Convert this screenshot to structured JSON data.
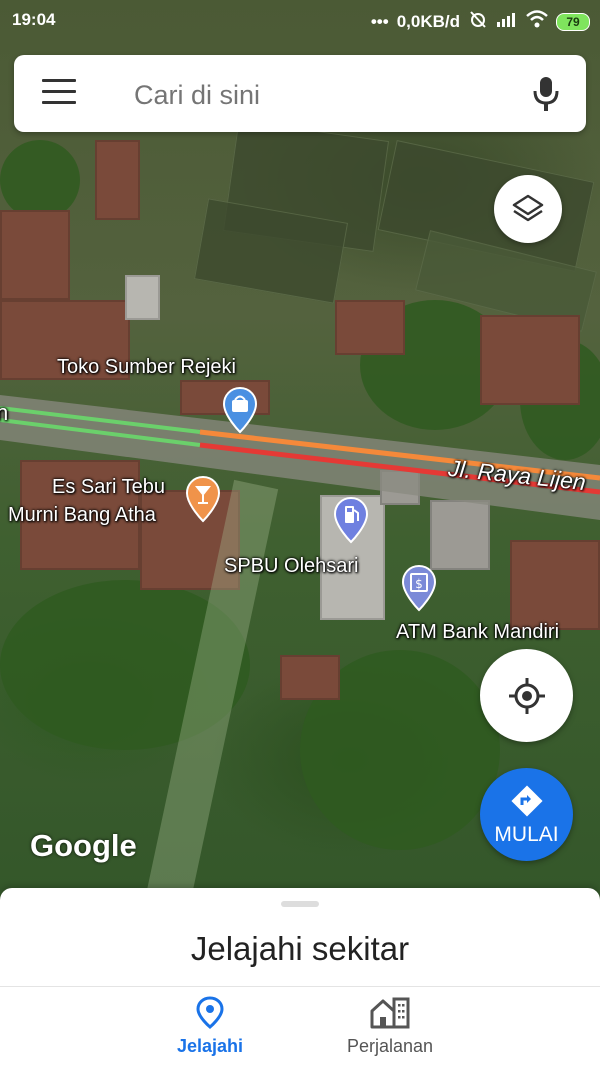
{
  "status_bar": {
    "time": "19:04",
    "network_speed": "0,0KB/d",
    "battery": "79",
    "icons": [
      "dots-icon",
      "alarm-off-icon",
      "signal-icon",
      "wifi-icon",
      "battery-icon"
    ]
  },
  "search": {
    "placeholder": "Cari di sini",
    "menu_icon": "hamburger-menu-icon",
    "mic_icon": "microphone-icon"
  },
  "map": {
    "labels": {
      "shop": "Toko Sumber Rejeki",
      "drink_line1": "Es Sari Tebu",
      "drink_line2": "Murni Bang Atha",
      "gas": "SPBU Olehsari",
      "atm": "ATM Bank Mandiri",
      "road": "Jl. Raya Lijen",
      "road_left_fragment": "n"
    },
    "pin_colors": {
      "shop": "#4a90e2",
      "drink": "#f0934a",
      "gas": "#6f80e0",
      "atm": "#7b8ad8"
    },
    "traffic_colors": {
      "green": "#6bd06b",
      "red": "#e53935",
      "orange": "#f5893a"
    },
    "attribution": "Google"
  },
  "fab": {
    "layers_icon": "layers-icon",
    "location_icon": "my-location-icon",
    "start_label": "MULAI",
    "start_icon": "directions-icon"
  },
  "sheet": {
    "title": "Jelajahi sekitar"
  },
  "nav": {
    "items": [
      {
        "label": "Jelajahi",
        "icon": "explore-pin-icon",
        "active": true
      },
      {
        "label": "Perjalanan",
        "icon": "commute-building-icon",
        "active": false
      }
    ]
  },
  "colors": {
    "accent": "#1a73e8"
  }
}
